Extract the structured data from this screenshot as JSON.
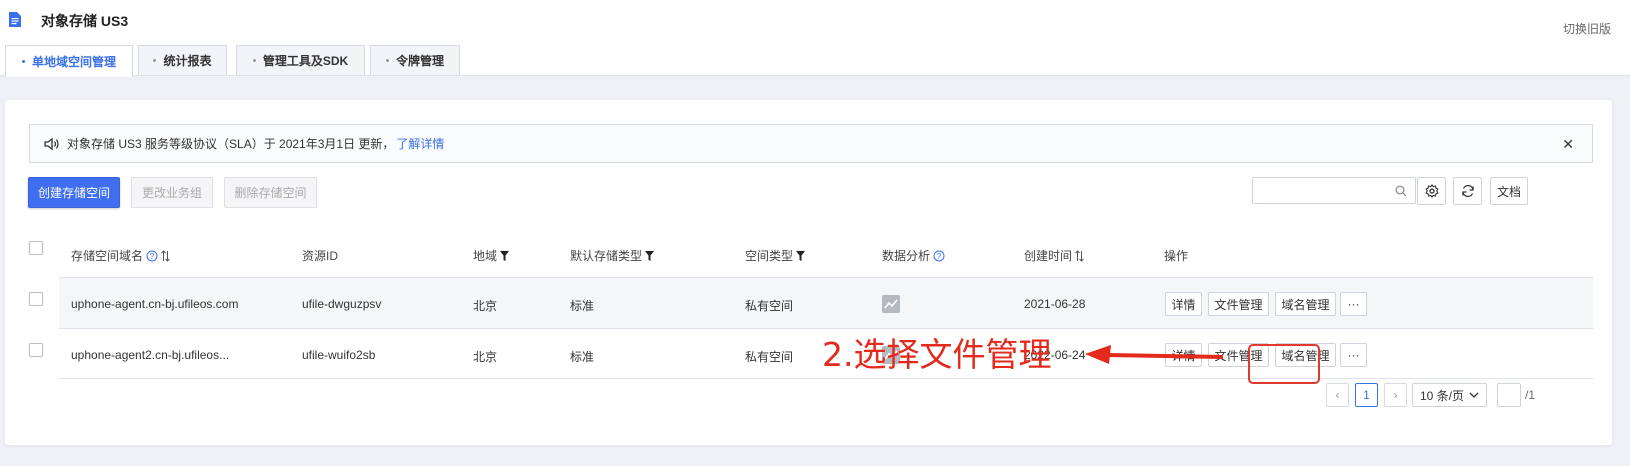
{
  "header": {
    "title": "对象存储 US3",
    "switch_label": "切换旧版"
  },
  "tabs": [
    {
      "label": "单地域空间管理",
      "active": true
    },
    {
      "label": "统计报表",
      "active": false
    },
    {
      "label": "管理工具及SDK",
      "active": false
    },
    {
      "label": "令牌管理",
      "active": false
    }
  ],
  "notice": {
    "text": "对象存储 US3 服务等级协议（SLA）于 2021年3月1日 更新，",
    "link": "了解详情"
  },
  "toolbar": {
    "create_label": "创建存储空间",
    "change_group_label": "更改业务组",
    "delete_label": "删除存储空间",
    "search_placeholder": "",
    "docs_label": "文档"
  },
  "table": {
    "columns": {
      "name": "存储空间域名",
      "resource_id": "资源ID",
      "region": "地域",
      "storage_type": "默认存储类型",
      "space_type": "空间类型",
      "analysis": "数据分析",
      "created": "创建时间",
      "actions": "操作"
    },
    "rows": [
      {
        "name": "uphone-agent.cn-bj.ufileos.com",
        "resource_id": "ufile-dwguzpsv",
        "region": "北京",
        "storage_type": "标准",
        "space_type": "私有空间",
        "created": "2021-06-28"
      },
      {
        "name": "uphone-agent2.cn-bj.ufileos...",
        "resource_id": "ufile-wuifo2sb",
        "region": "北京",
        "storage_type": "标准",
        "space_type": "私有空间",
        "created": "2022-06-24"
      }
    ],
    "actions": {
      "detail": "详情",
      "file_manage": "文件管理",
      "domain_manage": "域名管理",
      "more": "···"
    }
  },
  "pagination": {
    "current_page": "1",
    "page_size": "10 条/页",
    "total": "/1"
  },
  "annotation": {
    "text": "2.选择文件管理",
    "color": "#e32a1d"
  }
}
